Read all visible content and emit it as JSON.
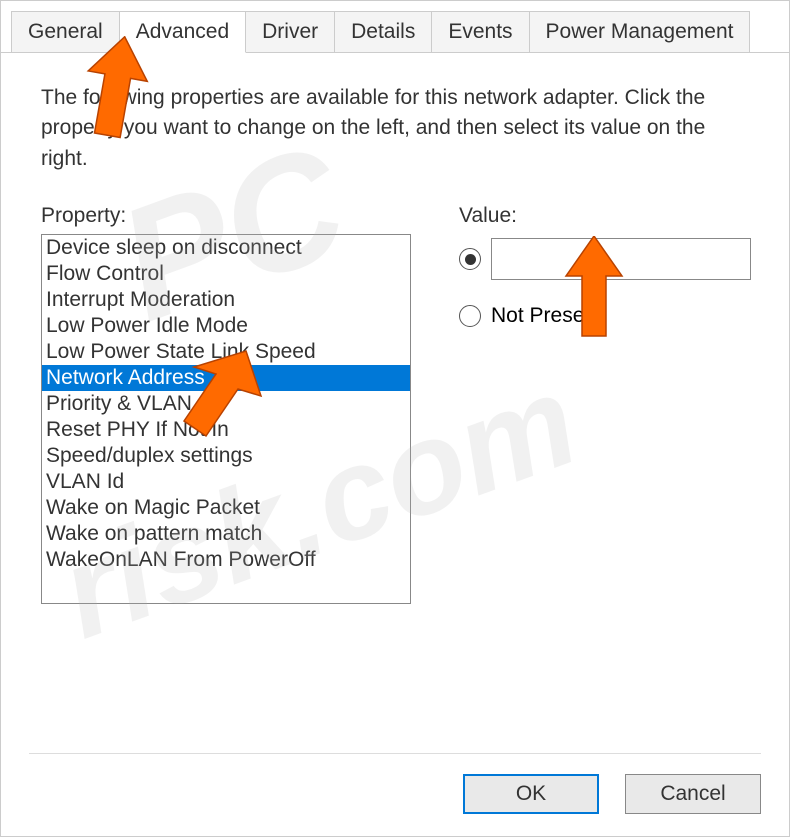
{
  "tabs": {
    "items": [
      {
        "label": "General"
      },
      {
        "label": "Advanced"
      },
      {
        "label": "Driver"
      },
      {
        "label": "Details"
      },
      {
        "label": "Events"
      },
      {
        "label": "Power Management"
      }
    ],
    "active_index": 1
  },
  "description": "The following properties are available for this network adapter. Click the property you want to change on the left, and then select its value on the right.",
  "property_label": "Property:",
  "value_label": "Value:",
  "properties": [
    "Device sleep on disconnect",
    "Flow Control",
    "Interrupt Moderation",
    "Low Power Idle Mode",
    "Low Power State Link Speed",
    "Network Address",
    "Priority & VLAN",
    "Reset PHY If Not In",
    "Speed/duplex settings",
    "VLAN Id",
    "Wake on Magic Packet",
    "Wake on pattern match",
    "WakeOnLAN From PowerOff"
  ],
  "selected_property_index": 5,
  "value_radio": {
    "value_selected": true,
    "input_value": "",
    "not_present_label": "Not Present"
  },
  "buttons": {
    "ok": "OK",
    "cancel": "Cancel"
  },
  "watermark_top": "PC",
  "watermark_bottom": "risk.com"
}
